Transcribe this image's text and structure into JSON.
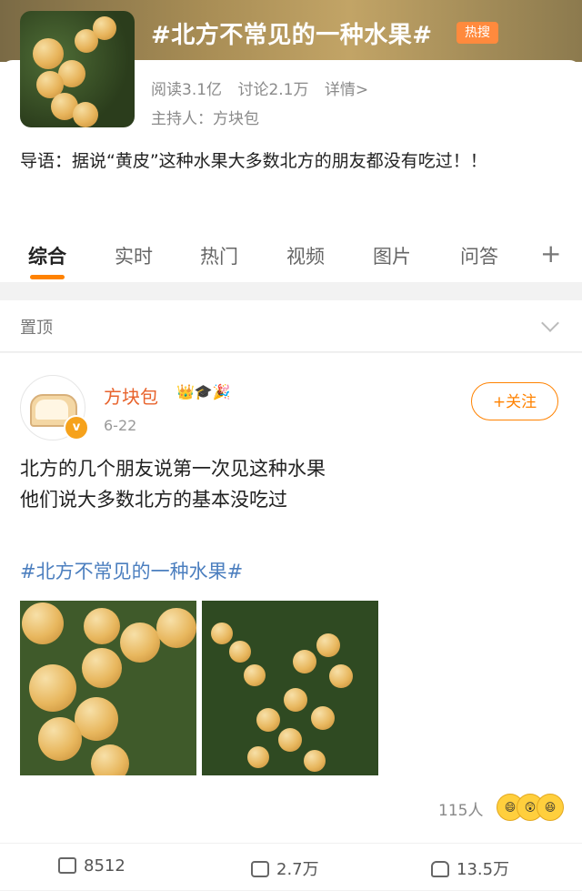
{
  "topic": {
    "title": "#北方不常见的一种水果#",
    "hot_badge": "热搜",
    "reads": "阅读3.1亿",
    "discussions": "讨论2.1万",
    "details": "详情>",
    "host": "主持人：方块包",
    "intro": "导语：据说“黄皮”这种水果大多数北方的朋友都没有吃过！！"
  },
  "tabs": [
    "综合",
    "实时",
    "热门",
    "视频",
    "图片",
    "问答"
  ],
  "tabs_add": "+",
  "pinned": {
    "label": "置顶"
  },
  "post": {
    "username": "方块包",
    "badge_icons": "👑🎓🎉",
    "verified_mark": "v",
    "date": "6-22",
    "follow_label": "+关注",
    "line1": "北方的几个朋友说第一次见这种水果",
    "line2": "他们说大多数北方的基本没吃过",
    "topic_link": "#北方不常见的一种水果#",
    "reaction_count": "115人",
    "reaction_emojis": [
      "😄",
      "😲",
      "😆"
    ],
    "repost": "8512",
    "comments": "2.7万",
    "likes": "13.5万"
  },
  "colors": {
    "accent": "#ff8200",
    "username": "#e8632c",
    "link": "#4c7fbf"
  }
}
